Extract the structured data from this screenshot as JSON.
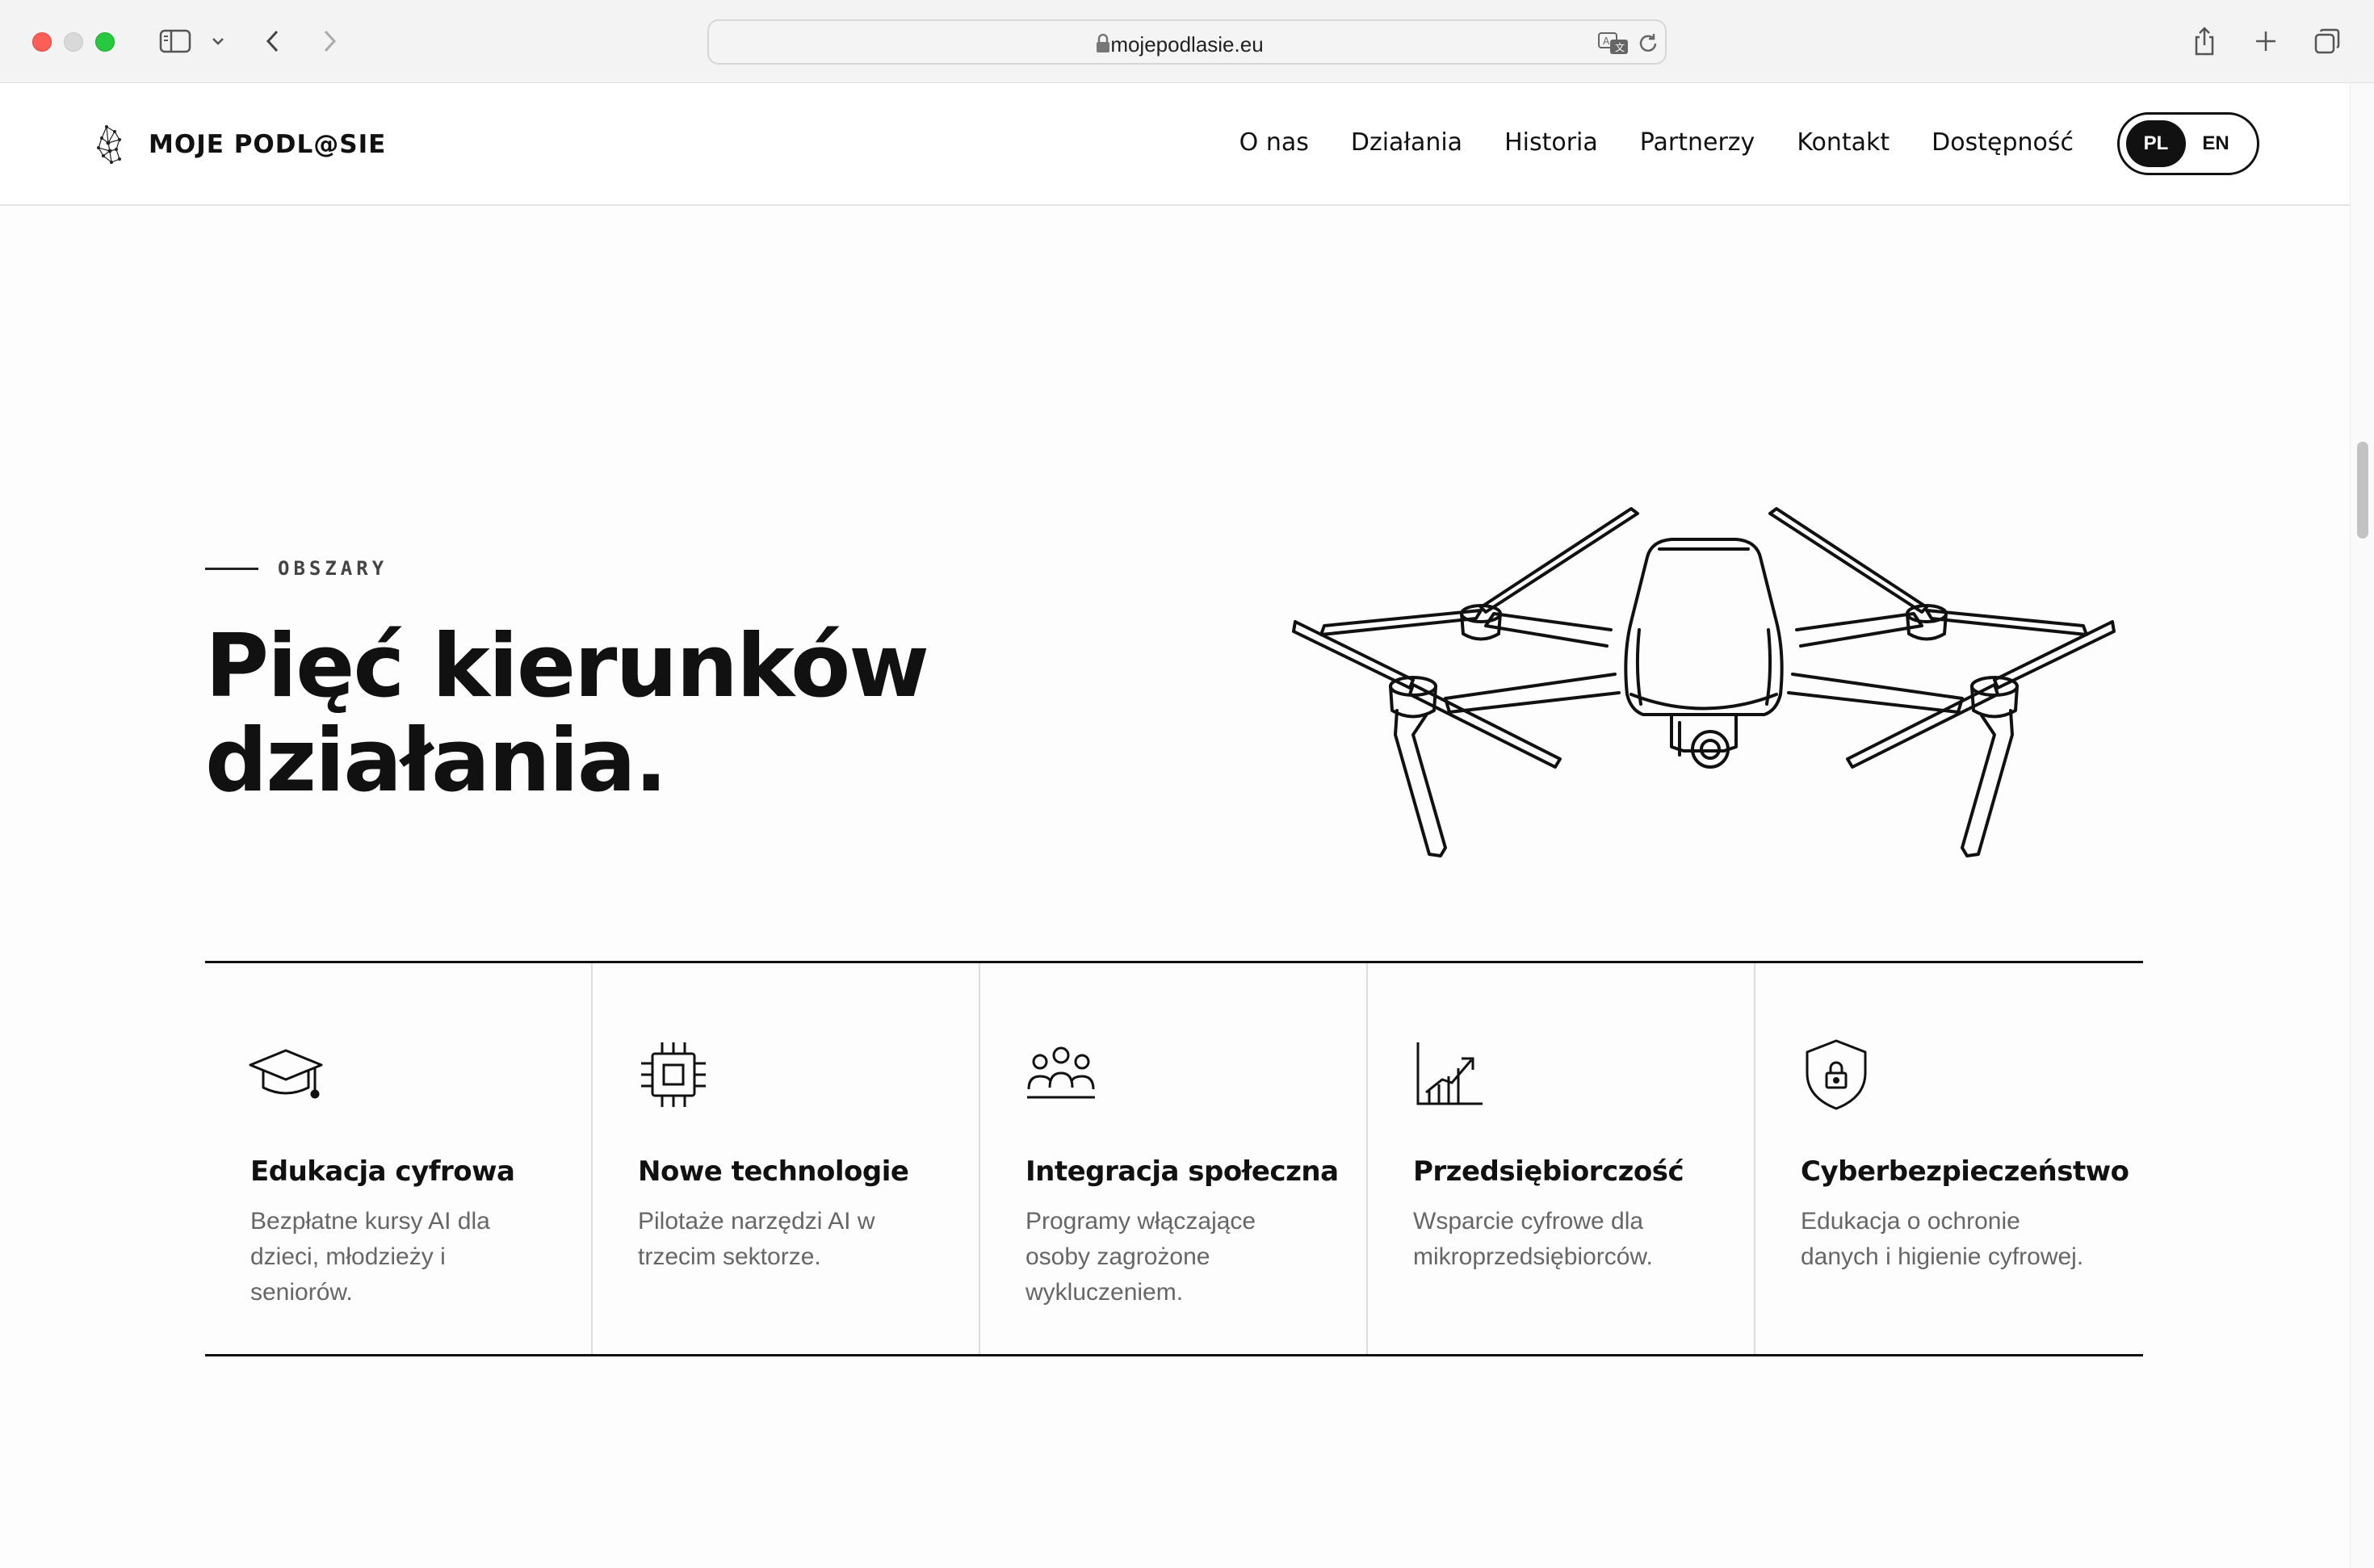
{
  "browser": {
    "url": "mojepodlasie.eu"
  },
  "header": {
    "logo_text": "MOJE PODL@SIE",
    "nav": [
      "O nas",
      "Działania",
      "Historia",
      "Partnerzy",
      "Kontakt",
      "Dostępność"
    ],
    "lang_active": "PL",
    "lang_other": "EN"
  },
  "hero": {
    "eyebrow": "OBSZARY",
    "headline_line1": "Pięć kierunków",
    "headline_line2": "działania."
  },
  "areas": [
    {
      "icon": "graduation-cap-icon",
      "title": "Edukacja cyfrowa",
      "desc": "Bezpłatne kursy AI dla dzieci, młodzieży i seniorów."
    },
    {
      "icon": "chip-icon",
      "title": "Nowe technologie",
      "desc": "Pilotaże narzędzi AI w trzecim sektorze."
    },
    {
      "icon": "people-icon",
      "title": "Integracja społeczna",
      "desc": "Programy włączające osoby zagrożone wykluczeniem."
    },
    {
      "icon": "growth-chart-icon",
      "title": "Przedsiębiorczość",
      "desc": "Wsparcie cyfrowe dla mikroprzedsiębiorców."
    },
    {
      "icon": "shield-lock-icon",
      "title": "Cyberbezpieczeństwo",
      "desc": "Edukacja o ochronie danych i higienie cyfrowej."
    }
  ],
  "colors": {
    "text": "#111111",
    "muted": "#666666",
    "accent": "#111111"
  }
}
